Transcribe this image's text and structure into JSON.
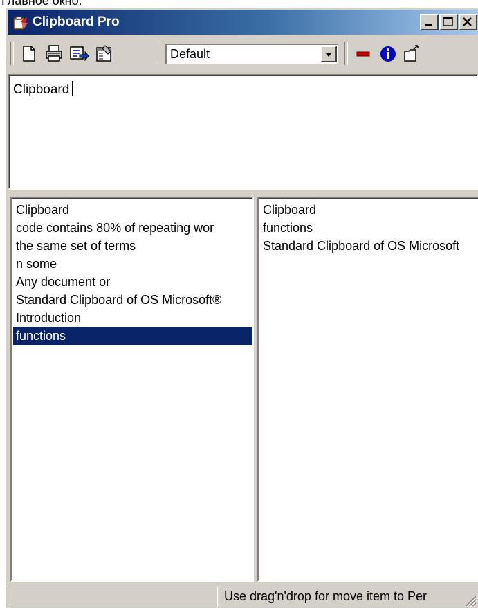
{
  "caption": {
    "text": "Главное окно:"
  },
  "window": {
    "title": "Clipboard Pro",
    "app_icon": "clipboard-app-icon",
    "caption_buttons": [
      "minimize-icon",
      "maximize-icon",
      "close-icon"
    ]
  },
  "toolbar": {
    "buttons": [
      "new-document-icon",
      "print-icon",
      "export-icon",
      "properties-icon"
    ],
    "profile_select": {
      "selected": "Default"
    },
    "right_buttons": [
      "delete-icon",
      "info-icon",
      "open-folder-icon"
    ],
    "colors": {
      "delete": "#cc0000",
      "info": "#0000cc"
    }
  },
  "editor": {
    "value": "Clipboard"
  },
  "left_list": {
    "items": [
      "Clipboard",
      "code contains 80% of repeating wor",
      "the same set of terms",
      "n some",
      "Any document or",
      "Standard Clipboard of OS Microsoft®",
      "Introduction",
      "functions"
    ],
    "selected_index": 7
  },
  "right_list": {
    "items": [
      "Clipboard",
      "functions",
      "Standard Clipboard of OS Microsoft"
    ]
  },
  "statusbar": {
    "left": "",
    "hint": "Use drag'n'drop for move item to Per"
  },
  "colors": {
    "title_start": "#0a246a",
    "title_end": "#a6caf0",
    "selection": "#0a246a",
    "face": "#d4d0c8"
  }
}
